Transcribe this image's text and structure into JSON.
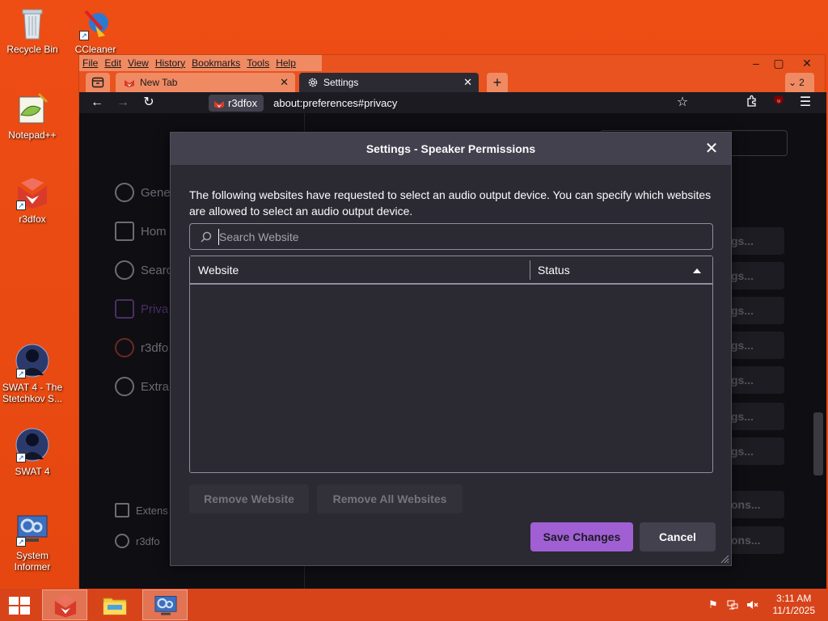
{
  "desktop": {
    "icons": [
      {
        "label": "Recycle Bin"
      },
      {
        "label": "CCleaner"
      },
      {
        "label": "Notepad++"
      },
      {
        "label": "r3dfox"
      },
      {
        "label": "SWAT 4 - The Stetchkov S..."
      },
      {
        "label": "SWAT 4"
      },
      {
        "label": "System Informer"
      }
    ]
  },
  "browser": {
    "menu": [
      "File",
      "Edit",
      "View",
      "History",
      "Bookmarks",
      "Tools",
      "Help"
    ],
    "tabs": [
      {
        "label": "New Tab",
        "icon": "r3dfox-icon"
      },
      {
        "label": "Settings",
        "icon": "gear-icon"
      }
    ],
    "tab_count": "2",
    "identity_label": "r3dfox",
    "url": "about:preferences#privacy",
    "sidebar": [
      {
        "label": "Gene",
        "icon": "gear-icon"
      },
      {
        "label": "Hom",
        "icon": "home-icon"
      },
      {
        "label": "Searc",
        "icon": "search-icon"
      },
      {
        "label": "Priva",
        "icon": "lock-icon"
      },
      {
        "label": "r3dfo",
        "icon": "r3dfox-icon"
      },
      {
        "label": "Extra",
        "icon": "gear-icon"
      }
    ],
    "sidebar_footer": [
      {
        "label": "Extens",
        "icon": "puzzle-icon"
      },
      {
        "label": "r3dfo",
        "icon": "help-icon"
      }
    ],
    "bg_buttons": [
      "gs...",
      "gs...",
      "gs...",
      "gs...",
      "gs...",
      "gs...",
      "gs...",
      "ons...",
      "ons..."
    ]
  },
  "dialog": {
    "title": "Settings - Speaker Permissions",
    "description": "The following websites have requested to select an audio output device. You can specify which websites are allowed to select an audio output device.",
    "search_placeholder": "Search Website",
    "columns": {
      "website": "Website",
      "status": "Status"
    },
    "rows": [],
    "remove_website": "Remove Website",
    "remove_all": "Remove All Websites",
    "save": "Save Changes",
    "cancel": "Cancel"
  },
  "taskbar": {
    "time": "3:11 AM",
    "date": "11/1/2025"
  },
  "colors": {
    "accent": "#a15fd4",
    "dialog_bg": "#2b2a33",
    "desktop": "#ee4d14"
  }
}
